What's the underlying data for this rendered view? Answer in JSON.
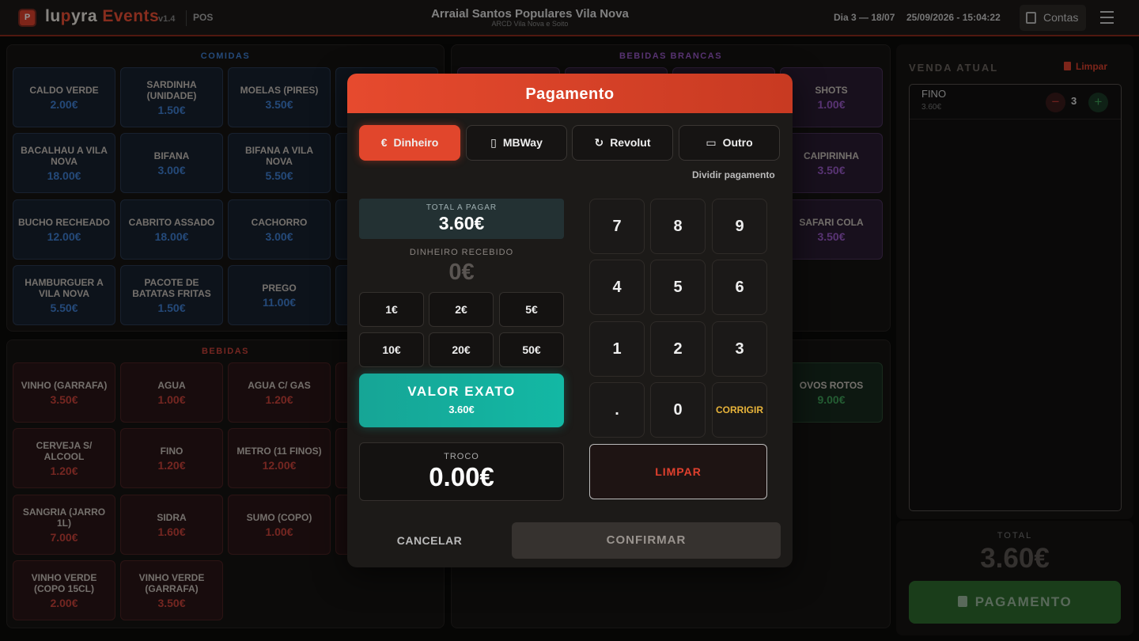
{
  "header": {
    "logo_letter": "P",
    "brand_a": "lu",
    "brand_b": "p",
    "brand_c": "yra",
    "brand_d": " Events",
    "version": "v1.4",
    "mode": "POS",
    "title": "Arraial Santos Populares Vila Nova",
    "subtitle": "ARCD Vila Nova e Soito",
    "day": "Dia 3 — 18/07",
    "datetime": "25/09/2026 - 15:04:22",
    "contas_label": "Contas"
  },
  "categories": {
    "comidas": {
      "title": "COMIDAS",
      "items": [
        {
          "name": "Caldo Verde",
          "price": "2.00€"
        },
        {
          "name": "Sardinha (unidade)",
          "price": "1.50€"
        },
        {
          "name": "Moelas (pires)",
          "price": "3.50€"
        },
        {
          "name": "Bacalhau a Vila Nova",
          "price": "18.00€"
        },
        {
          "name": "Bifana",
          "price": "3.00€"
        },
        {
          "name": "Bifana a Vila Nova",
          "price": "5.50€"
        },
        {
          "name": "Bucho Recheado",
          "price": "12.00€"
        },
        {
          "name": "Cabrito Assado",
          "price": "18.00€"
        },
        {
          "name": "Cachorro",
          "price": "3.00€"
        },
        {
          "name": "Hamburguer a Vila Nova",
          "price": "5.50€"
        },
        {
          "name": "Pacote de Batatas Fritas",
          "price": "1.50€"
        },
        {
          "name": "Prego",
          "price": "11.00€"
        }
      ]
    },
    "bebidas_brancas": {
      "title": "BEBIDAS BRANCAS",
      "items": [
        {
          "name": "Shots",
          "price": "1.00€"
        },
        {
          "name": "Caipirinha",
          "price": "3.50€"
        },
        {
          "name": "Safari Cola",
          "price": "3.50€"
        }
      ]
    },
    "bebidas": {
      "title": "BEBIDAS",
      "items": [
        {
          "name": "Vinho (garrafa)",
          "price": "3.50€"
        },
        {
          "name": "Agua",
          "price": "1.00€"
        },
        {
          "name": "Agua c/ Gas",
          "price": "1.20€"
        },
        {
          "name": "Cerveja s/ Alcool",
          "price": "1.20€"
        },
        {
          "name": "Fino",
          "price": "1.20€"
        },
        {
          "name": "Metro (11 Finos)",
          "price": "12.00€"
        },
        {
          "name": "Sangria (jarro 1l)",
          "price": "7.00€"
        },
        {
          "name": "Sidra",
          "price": "1.60€"
        },
        {
          "name": "Sumo (copo)",
          "price": "1.00€"
        },
        {
          "name": "Vinho Verde (copo 15cl)",
          "price": "2.00€"
        },
        {
          "name": "Vinho Verde (garrafa)",
          "price": "3.50€"
        }
      ]
    },
    "outros": {
      "items": [
        {
          "name": "Ovos Rotos",
          "price": "9.00€"
        }
      ]
    }
  },
  "sale": {
    "title": "VENDA ATUAL",
    "clear_label": "Limpar",
    "items": [
      {
        "name": "FINO",
        "unit_price": "3.60€",
        "qty": "3"
      }
    ],
    "total_label": "TOTAL",
    "total": "3.60€",
    "pay_label": "PAGAMENTO"
  },
  "modal": {
    "title": "Pagamento",
    "methods": [
      {
        "label": "Dinheiro",
        "icon": "€"
      },
      {
        "label": "MBWay",
        "icon": "▯"
      },
      {
        "label": "Revolut",
        "icon": "↻"
      },
      {
        "label": "Outro",
        "icon": "▭"
      }
    ],
    "selected_method": "Dinheiro",
    "split_label": "Dividir pagamento",
    "total_label": "TOTAL A PAGAR",
    "total": "3.60€",
    "received_label": "DINHEIRO RECEBIDO",
    "received": "0€",
    "quick": [
      "1€",
      "2€",
      "5€",
      "10€",
      "20€",
      "50€"
    ],
    "exact_label": "VALOR EXATO",
    "exact_value": "3.60€",
    "change_label": "TROCO",
    "change": "0.00€",
    "keys": [
      "7",
      "8",
      "9",
      "4",
      "5",
      "6",
      "1",
      "2",
      "3",
      ".",
      "0",
      "CORRIGIR"
    ],
    "clear_label": "LIMPAR",
    "cancel_label": "CANCELAR",
    "confirm_label": "CONFIRMAR"
  },
  "colors": {
    "accent": "#e1462c",
    "teal": "#13b8a4",
    "green": "#2d6a2e",
    "blue_price": "#3f7fd0",
    "red_price": "#c8423a",
    "purple_price": "#9a5ac8"
  }
}
